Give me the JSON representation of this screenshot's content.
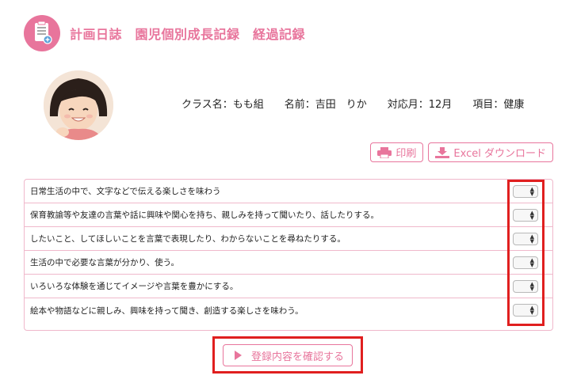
{
  "header": {
    "logo_icon": "clipboard-icon",
    "title": "計画日誌　園児個別成長記録　経過記録"
  },
  "profile": {
    "class": "クラス名：もも組",
    "name": "名前：吉田　りか",
    "month": "対応月：12月",
    "item": "項目：健康"
  },
  "toolbar": {
    "print_label": "印刷",
    "print_icon": "printer-icon",
    "excel_label": "Excel ダウンロード",
    "excel_icon": "download-icon"
  },
  "items": [
    {
      "text": "日常生活の中で、文字などで伝える楽しさを味わう",
      "selected": ""
    },
    {
      "text": "保育教諭等や友達の言葉や話に興味や関心を持ち、親しみを持って聞いたり、話したりする。",
      "selected": ""
    },
    {
      "text": "したいこと、してほしいことを言葉で表現したり、わからないことを尋ねたりする。",
      "selected": ""
    },
    {
      "text": "生活の中で必要な言葉が分かり、使う。",
      "selected": ""
    },
    {
      "text": "いろいろな体験を通じてイメージや言葉を豊かにする。",
      "selected": ""
    },
    {
      "text": "絵本や物語などに親しみ、興味を持って聞き、創造する楽しさを味わう。",
      "selected": ""
    }
  ],
  "confirm": {
    "label": "登録内容を確認する",
    "icon": "play-icon"
  },
  "colors": {
    "accent": "#e8759c",
    "highlight": "#e01f1f"
  }
}
